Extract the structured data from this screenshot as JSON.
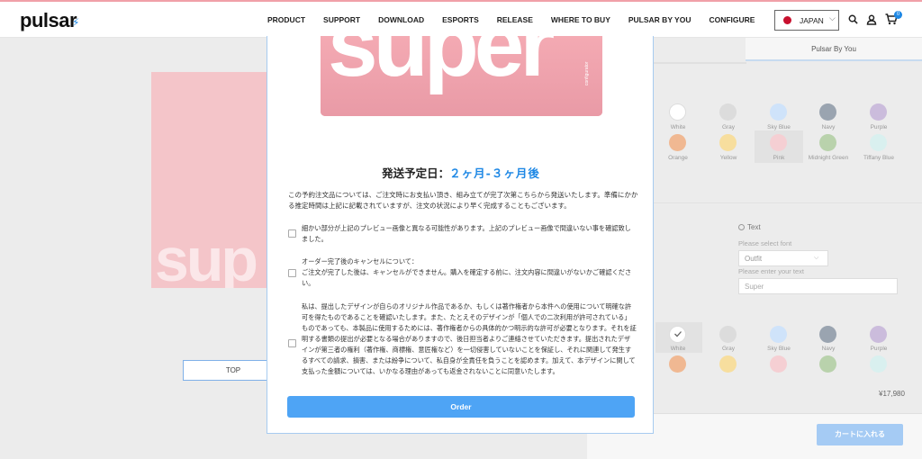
{
  "nav": {
    "logo": "pulsar",
    "links": [
      "PRODUCT",
      "SUPPORT",
      "DOWNLOAD",
      "ESPORTS",
      "RELEASE",
      "WHERE TO BUY",
      "PULSAR BY YOU",
      "CONFIGURE"
    ],
    "country": "JAPAN",
    "cart_count": "0"
  },
  "background": {
    "card_text": "sup",
    "top_button": "TOP",
    "tab_label": "Pulsar By You",
    "swatches_row1": [
      "White",
      "Gray",
      "Sky Blue",
      "Navy",
      "Purple"
    ],
    "swatches_row2": [
      "Orange",
      "Yellow",
      "Pink",
      "Midnight Green",
      "Tiffany Blue"
    ],
    "swatches_row3": [
      "White",
      "Gray",
      "Sky Blue",
      "Navy",
      "Purple"
    ],
    "swatch_colors": [
      "#ffffff",
      "#dcdcdc",
      "#cfe3fa",
      "#9aa4b0",
      "#cbbcdc",
      "#f0b892",
      "#f7de9e",
      "#f5cfd3",
      "#b9d2ac",
      "#d9f0ef"
    ],
    "text_option": "Text",
    "font_label": "Please select font",
    "font_value": "Outfit",
    "text_label": "Please enter your text",
    "text_value": "Super",
    "price": "¥17,980",
    "cart_button": "カートに入れる"
  },
  "modal": {
    "preview_text": "super",
    "preview_small": "configurator",
    "ship_label": "発送予定日：",
    "ship_value": "２ヶ月-３ヶ月後",
    "paragraph": "この予約注文品については、ご注文時にお支払い頂き、組み立てが完了次第こちらから発送いたします。準備にかかる推定時間は上記に記載されていますが、注文の状況により早く完成することもございます。",
    "check1": "細かい部分が上記のプレビュー画像と異なる可能性があります。上記のプレビュー画像で間違いない事を確認致しました。",
    "check2": "オーダー完了後のキャンセルについて：\nご注文が完了した後は、キャンセルができません。購入を確定する前に、注文内容に間違いがないかご確認ください。",
    "check3": "私は、提出したデザインが自らのオリジナル作品であるか、もしくは著作権者から本件への使用について明確な許可を得たものであることを確認いたします。また、たとえそのデザインが「個人での二次利用が許可されている」ものであっても、本製品に使用するためには、著作権者からの具体的かつ明示的な許可が必要となります。それを証明する書類の提出が必要となる場合がありますので、後日担当者よりご連絡させていただきます。提出されたデザインが第三者の権利（著作権、商標権、意匠権など）を一切侵害していないことを保証し、それに関連して発生するすべての請求、損害、または紛争について、私自身が全責任を負うことを認めます。加えて、本デザインに関して支払った金額については、いかなる理由があっても返金されないことに同意いたします。",
    "order_button": "Order"
  }
}
